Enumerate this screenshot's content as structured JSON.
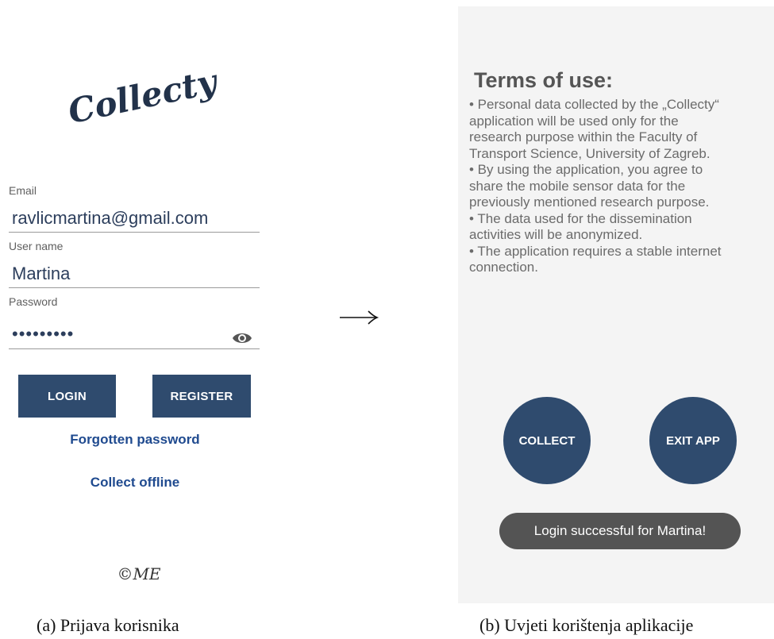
{
  "login_screen": {
    "logo_text": "Collecty",
    "email": {
      "label": "Email",
      "value": "ravlicmartina@gmail.com"
    },
    "username": {
      "label": "User name",
      "value": "Martina"
    },
    "password": {
      "label": "Password",
      "masked_value": "•••••••••"
    },
    "login_button": "LOGIN",
    "register_button": "REGISTER",
    "forgotten_password_link": "Forgotten password",
    "collect_offline_link": "Collect offline",
    "copyright_mark": "©ME",
    "icons": {
      "password_toggle": "eye-icon"
    },
    "colors": {
      "button": "#2f4b6e",
      "link": "#1f4a8f"
    }
  },
  "terms_screen": {
    "title": "Terms of use:",
    "lines": [
      "• Personal data collected by the „Collecty“",
      "application will be used only for the",
      "research purpose within the Faculty of",
      "Transport Science, University of Zagreb.",
      "• By using the application, you agree to",
      "share the mobile sensor data for the",
      "previously mentioned research purpose.",
      "• The data used for the dissemination",
      "activities will be anonymized.",
      "• The application requires a stable internet",
      "connection."
    ],
    "collect_button": "COLLECT",
    "exit_button": "EXIT APP",
    "toast": "Login successful for Martina!"
  },
  "captions": {
    "left": "(a) Prijava korisnika",
    "right": "(b) Uvjeti korištenja aplikacije"
  }
}
